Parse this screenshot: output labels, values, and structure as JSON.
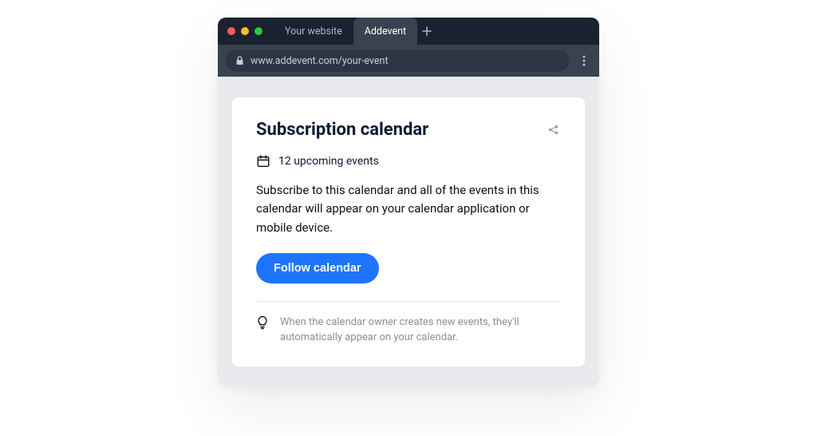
{
  "browser": {
    "tabs": {
      "inactive_label": "Your website",
      "active_label": "Addevent"
    },
    "url": "www.addevent.com/your-event"
  },
  "card": {
    "title": "Subscription calendar",
    "upcoming_text": "12 upcoming events",
    "description": "Subscribe to this calendar and all of the events in this calendar will appear on your calendar application or mobile device.",
    "follow_label": "Follow calendar",
    "tip_text": "When the calendar owner creates new events, they'll automatically appear on your calendar."
  }
}
